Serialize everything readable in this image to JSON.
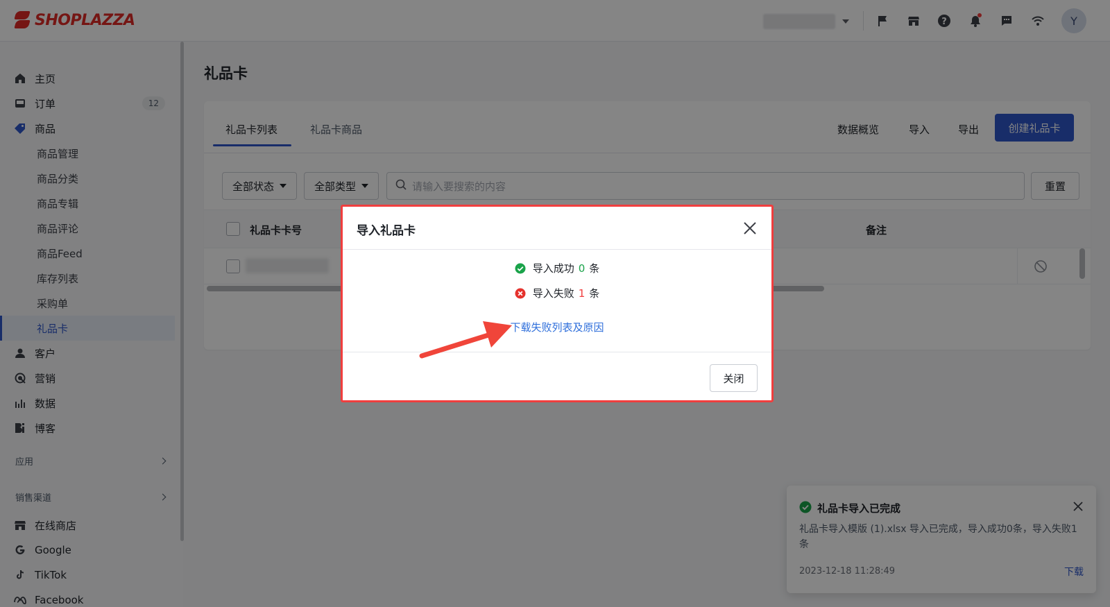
{
  "brand": {
    "name": "SHOPLAZZA",
    "color": "#e02b27"
  },
  "topbar": {
    "avatar_letter": "Y",
    "icons": [
      "flag-icon",
      "store-icon",
      "help-icon",
      "bell-icon",
      "message-icon",
      "wifi-icon"
    ]
  },
  "sidebar": {
    "items": [
      {
        "label": "主页",
        "icon": "home-icon"
      },
      {
        "label": "订单",
        "icon": "inbox-icon",
        "count": "12"
      },
      {
        "label": "商品",
        "icon": "tag-icon"
      },
      {
        "label": "客户",
        "icon": "user-icon"
      },
      {
        "label": "营销",
        "icon": "marketing-icon"
      },
      {
        "label": "数据",
        "icon": "bar-chart-icon"
      },
      {
        "label": "博客",
        "icon": "blog-icon"
      }
    ],
    "sub_items": [
      "商品管理",
      "商品分类",
      "商品专辑",
      "商品评论",
      "商品Feed",
      "库存列表",
      "采购单",
      "礼品卡"
    ],
    "sections": {
      "apps": "应用",
      "channels": "销售渠道"
    },
    "channels": [
      "在线商店",
      "Google",
      "TikTok",
      "Facebook"
    ]
  },
  "main": {
    "title": "礼品卡",
    "tabs": [
      "礼品卡列表",
      "礼品卡商品"
    ],
    "actions": {
      "overview": "数据概览",
      "import": "导入",
      "export": "导出",
      "create": "创建礼品卡"
    },
    "filters": {
      "status": "全部状态",
      "type": "全部类型",
      "search_placeholder": "请输入要搜索的内容",
      "reset": "重置"
    },
    "table": {
      "col_card_no": "礼品卡卡号",
      "col_note": "备注"
    }
  },
  "modal": {
    "title": "导入礼品卡",
    "success_prefix": "导入成功",
    "success_count": "0",
    "fail_prefix": "导入失败",
    "fail_count": "1",
    "unit": "条",
    "download_link": "下载失败列表及原因",
    "close_button": "关闭"
  },
  "toast": {
    "title": "礼品卡导入已完成",
    "body": "礼品卡导入模版 (1).xlsx 导入已完成，导入成功0条，导入失败1条",
    "time": "2023-12-18 11:28:49",
    "download": "下载"
  },
  "colors": {
    "primary": "#2e56c9",
    "success": "#1aa34a",
    "danger": "#f03e3e",
    "link": "#2f6fdb"
  }
}
